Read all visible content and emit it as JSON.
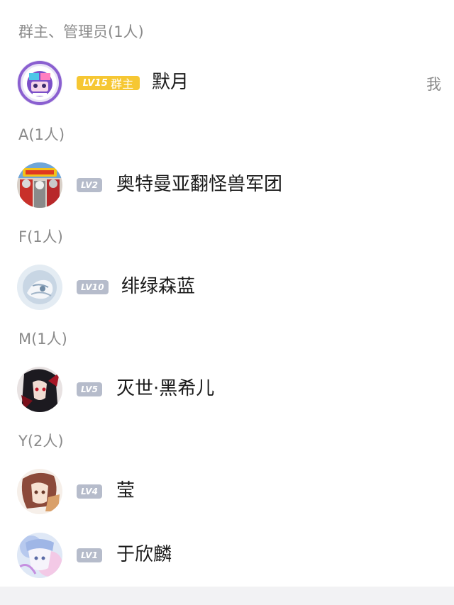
{
  "sections": [
    {
      "header": "群主、管理员(1人)",
      "members": [
        {
          "level": "LV15",
          "role": "群主",
          "name": "默月",
          "tag": "我"
        }
      ]
    },
    {
      "header": "A(1人)",
      "members": [
        {
          "level": "LV2",
          "name": "奥特曼亚翻怪兽军团"
        }
      ]
    },
    {
      "header": "F(1人)",
      "members": [
        {
          "level": "LV10",
          "name": "绯绿森蓝"
        }
      ]
    },
    {
      "header": "M(1人)",
      "members": [
        {
          "level": "LV5",
          "name": "灭世·黑希儿"
        }
      ]
    },
    {
      "header": "Y(2人)",
      "members": [
        {
          "level": "LV4",
          "name": "莹"
        },
        {
          "level": "LV1",
          "name": "于欣麟"
        }
      ]
    }
  ],
  "colors": {
    "owner_badge": "#f6c733",
    "level_badge": "#b6bccb",
    "header_text": "#8a8a8a",
    "name_text": "#1a1a1a"
  }
}
